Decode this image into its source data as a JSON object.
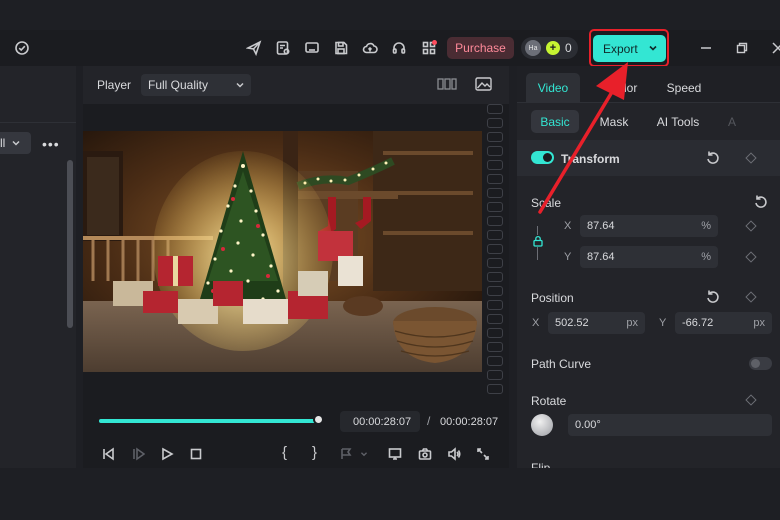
{
  "toolbar": {
    "icons": [
      "send-icon",
      "document-settings-icon",
      "monitor-icon",
      "save-icon",
      "cloud-upload-icon",
      "headset-icon",
      "grid-icon"
    ],
    "purchase_label": "Purchase",
    "avatar_initials": "Ha",
    "coin_symbol": "+",
    "credits": "0",
    "export_label": "Export"
  },
  "left_panel": {
    "dropdown_value": "ll",
    "more_label": "•••"
  },
  "player": {
    "title": "Player",
    "quality": "Full Quality",
    "current_time": "00:00:28:07",
    "separator": "/",
    "total_time": "00:00:28:07",
    "progress": 1.0,
    "brace_open": "{",
    "brace_close": "}"
  },
  "properties": {
    "main_tabs": [
      "Video",
      "Color",
      "Speed"
    ],
    "active_main_tab": "Video",
    "sub_tabs": [
      "Basic",
      "Mask",
      "AI Tools",
      "A"
    ],
    "active_sub_tab": "Basic",
    "transform": {
      "label": "Transform",
      "enabled": true,
      "scale_label": "Scale",
      "scale_x_axis": "X",
      "scale_x": "87.64",
      "scale_y_axis": "Y",
      "scale_y": "87.64",
      "scale_unit": "%",
      "position_label": "Position",
      "pos_x_axis": "X",
      "pos_x": "502.52",
      "pos_y_axis": "Y",
      "pos_y": "-66.72",
      "pos_unit": "px",
      "path_curve_label": "Path Curve",
      "path_curve_enabled": false,
      "rotate_label": "Rotate",
      "rotate_value": "0.00°",
      "flip_label": "Flip"
    }
  },
  "colors": {
    "accent": "#33e6d3",
    "purchase_text": "#ff8a9a",
    "highlight": "#e8202a"
  }
}
